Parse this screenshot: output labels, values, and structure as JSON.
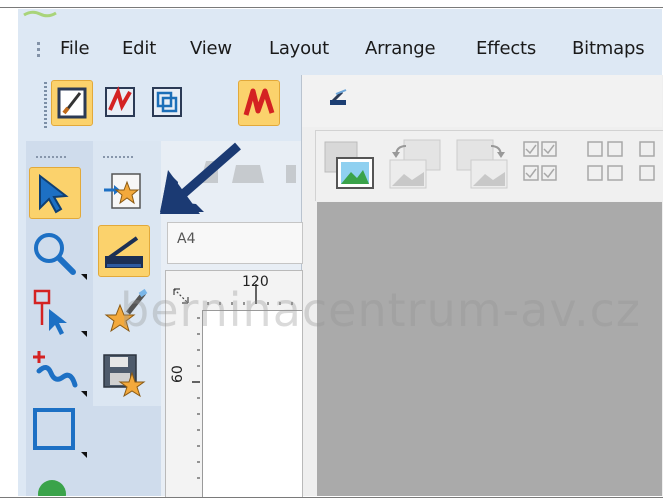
{
  "menu": {
    "items": [
      {
        "label": "File"
      },
      {
        "label": "Edit"
      },
      {
        "label": "View"
      },
      {
        "label": "Layout"
      },
      {
        "label": "Arrange"
      },
      {
        "label": "Effects"
      },
      {
        "label": "Bitmaps"
      }
    ]
  },
  "toolbar": {
    "buttons": [
      {
        "icon": "brush-frame-icon",
        "state": "selected"
      },
      {
        "icon": "embroidery-red-icon",
        "state": "normal"
      },
      {
        "icon": "overlap-frames-icon",
        "state": "normal"
      },
      {
        "icon": "zigzag-stitch-icon",
        "state": "selected"
      }
    ]
  },
  "right_panel": {
    "top_icon": "scanner-icon",
    "toolbar_icons": [
      "image-insert-icon",
      "rotate-left-icon",
      "rotate-right-icon",
      "grid-select-icon"
    ]
  },
  "left_tools": [
    "select-arrow-icon",
    "zoom-icon",
    "node-edit-icon",
    "freehand-stitch-icon",
    "rectangle-icon"
  ],
  "second_tools": [
    "import-shape-icon",
    "scanner-tool-icon",
    "magic-wand-icon",
    "save-design-icon"
  ],
  "document": {
    "paper_size": "A4",
    "ruler_top_label": "120",
    "ruler_left_label": "60"
  },
  "watermark": "berninacentrum-av.cz",
  "colors": {
    "accent_selected": "#fbd26c",
    "app_bg": "#dde8f4",
    "arrow_annotation": "#1b3a73",
    "canvas_grey": "#aaaaaa"
  }
}
